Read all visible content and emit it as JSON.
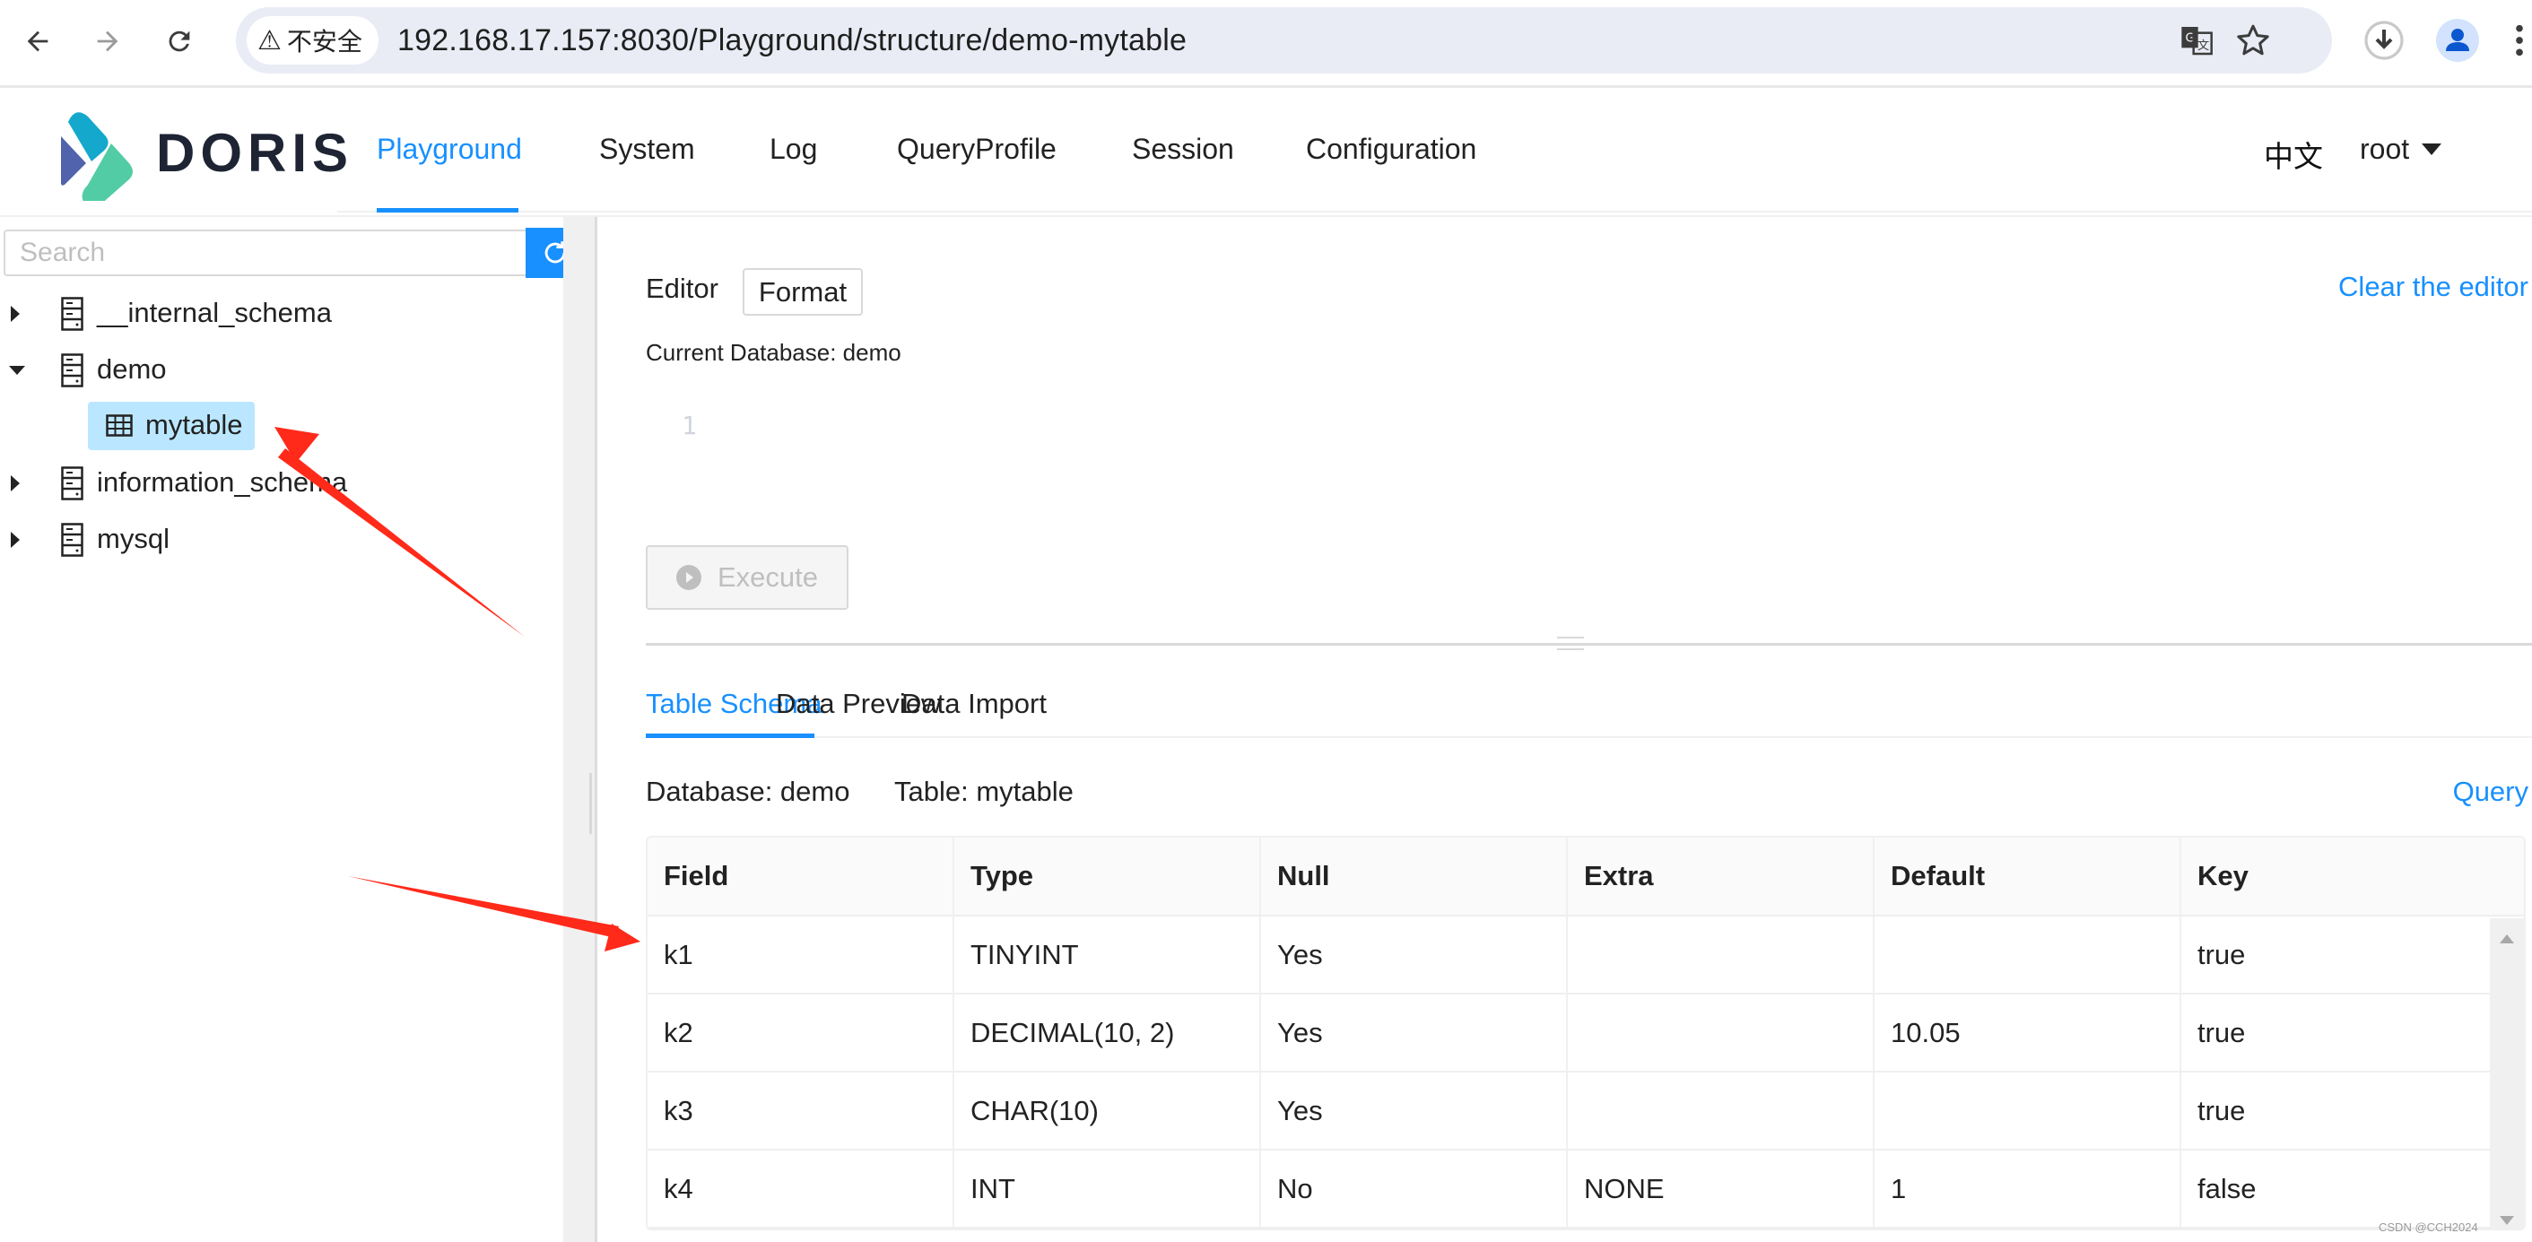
{
  "browser": {
    "security_label": "不安全",
    "url": "192.168.17.157:8030/Playground/structure/demo-mytable",
    "icons": [
      "back-icon",
      "forward-icon",
      "reload-icon",
      "warning-icon",
      "translate-icon",
      "bookmark-star-icon",
      "download-icon",
      "profile-icon",
      "more-menu-icon"
    ]
  },
  "header": {
    "logo_text": "DORIS",
    "menu": [
      {
        "label": "Playground",
        "active": true
      },
      {
        "label": "System"
      },
      {
        "label": "Log"
      },
      {
        "label": "QueryProfile"
      },
      {
        "label": "Session"
      },
      {
        "label": "Configuration"
      }
    ],
    "language": "中文",
    "user": "root"
  },
  "sidebar": {
    "search_placeholder": "Search",
    "search_value": "",
    "tree": [
      {
        "label": "__internal_schema",
        "type": "database",
        "expanded": false
      },
      {
        "label": "demo",
        "type": "database",
        "expanded": true
      },
      {
        "label": "mytable",
        "type": "table",
        "selected": true
      },
      {
        "label": "information_schema",
        "type": "database",
        "expanded": false
      },
      {
        "label": "mysql",
        "type": "database",
        "expanded": false
      }
    ]
  },
  "editor": {
    "label": "Editor",
    "format_button": "Format",
    "clear_link": "Clear the editor",
    "current_database": "Current Database: demo",
    "line_numbers": [
      "1"
    ],
    "content": "",
    "execute_button": "Execute"
  },
  "tabs": [
    {
      "label": "Table Schema",
      "active": true
    },
    {
      "label": "Data Preview"
    },
    {
      "label": "Data Import"
    }
  ],
  "schema": {
    "database_label": "Database: demo",
    "table_label": "Table: mytable",
    "query_link": "Query",
    "columns": [
      "Field",
      "Type",
      "Null",
      "Extra",
      "Default",
      "Key"
    ],
    "rows": [
      [
        "k1",
        "TINYINT",
        "Yes",
        "",
        "",
        "true"
      ],
      [
        "k2",
        "DECIMAL(10, 2)",
        "Yes",
        "",
        "10.05",
        "true"
      ],
      [
        "k3",
        "CHAR(10)",
        "Yes",
        "",
        "",
        "true"
      ],
      [
        "k4",
        "INT",
        "No",
        "NONE",
        "1",
        "false"
      ]
    ]
  },
  "colors": {
    "accent": "#1890ff",
    "selected_bg": "#bae7ff",
    "annotation_arrow": "#ff2a1a"
  },
  "watermark": "CSDN @CCH2024"
}
